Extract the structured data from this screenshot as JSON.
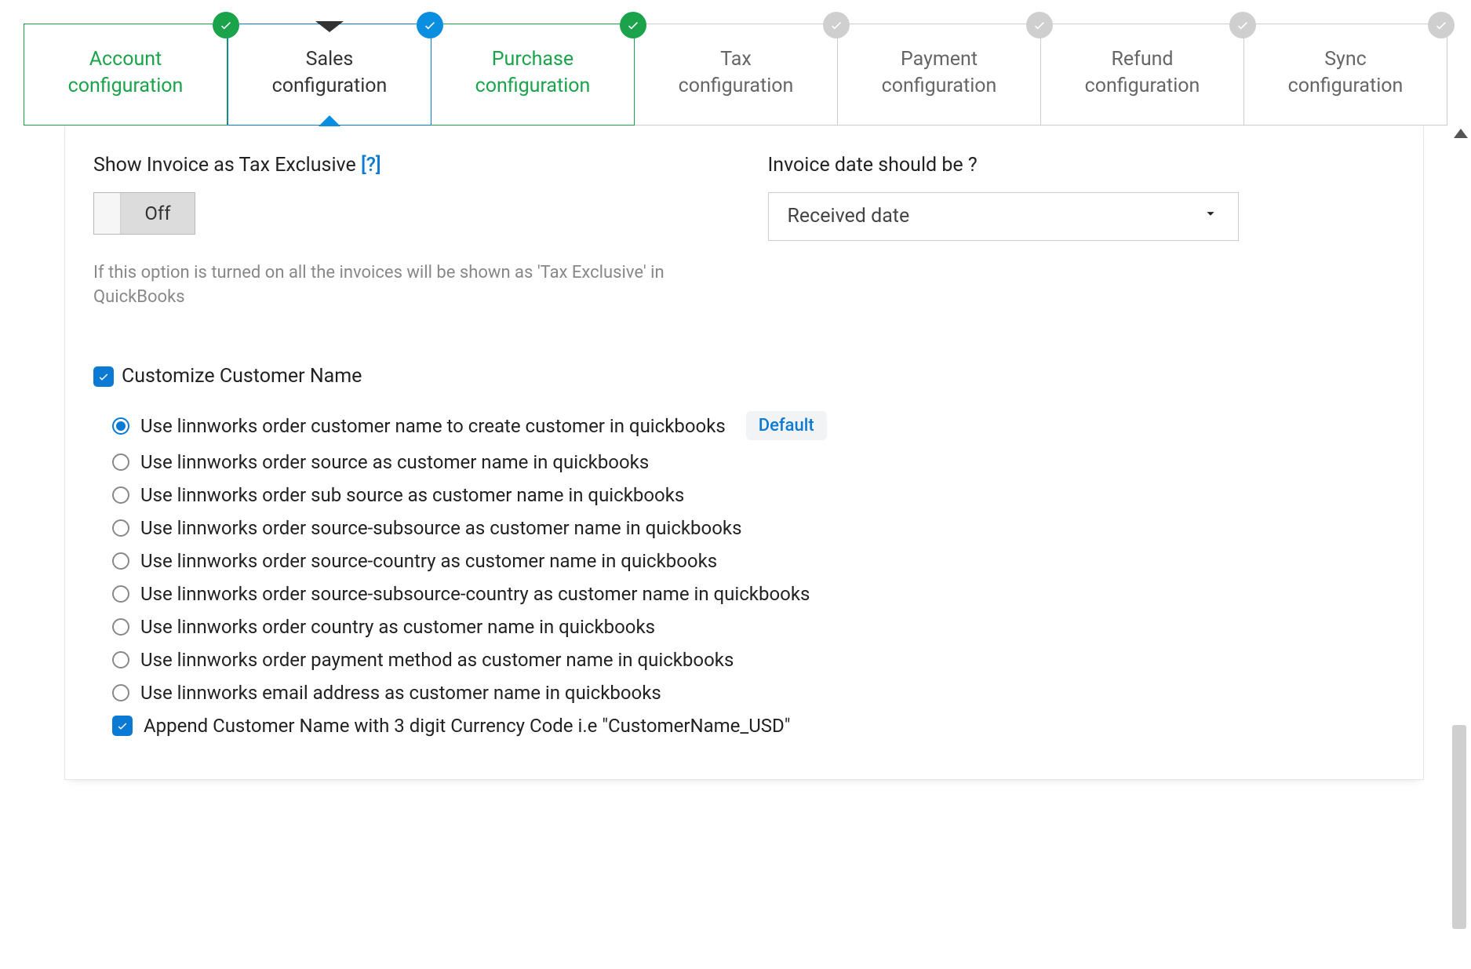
{
  "tabs": [
    {
      "label": "Account\nconfiguration"
    },
    {
      "label": "Sales\nconfiguration"
    },
    {
      "label": "Purchase\nconfiguration"
    },
    {
      "label": "Tax\nconfiguration"
    },
    {
      "label": "Payment\nconfiguration"
    },
    {
      "label": "Refund\nconfiguration"
    },
    {
      "label": "Sync\nconfiguration"
    }
  ],
  "showInvoice": {
    "label": "Show Invoice as Tax Exclusive",
    "help": "[?]",
    "toggle": "Off",
    "hint": "If this option is turned on all the invoices will be shown as 'Tax Exclusive' in QuickBooks"
  },
  "invoiceDate": {
    "label": "Invoice date should be ?",
    "value": "Received date"
  },
  "customize": {
    "checkbox": "Customize Customer Name",
    "defaultChip": "Default",
    "options": [
      "Use linnworks order customer name to create customer in quickbooks",
      "Use linnworks order source as customer name in quickbooks",
      "Use linnworks order sub source as customer name in quickbooks",
      "Use linnworks order source-subsource as customer name in quickbooks",
      "Use linnworks order source-country as customer name in quickbooks",
      "Use linnworks order source-subsource-country as customer name in quickbooks",
      "Use linnworks order country as customer name in quickbooks",
      "Use linnworks order payment method as customer name in quickbooks",
      "Use linnworks email address as customer name in quickbooks"
    ],
    "append": "Append Customer Name with 3 digit Currency Code i.e \"CustomerName_USD\""
  }
}
